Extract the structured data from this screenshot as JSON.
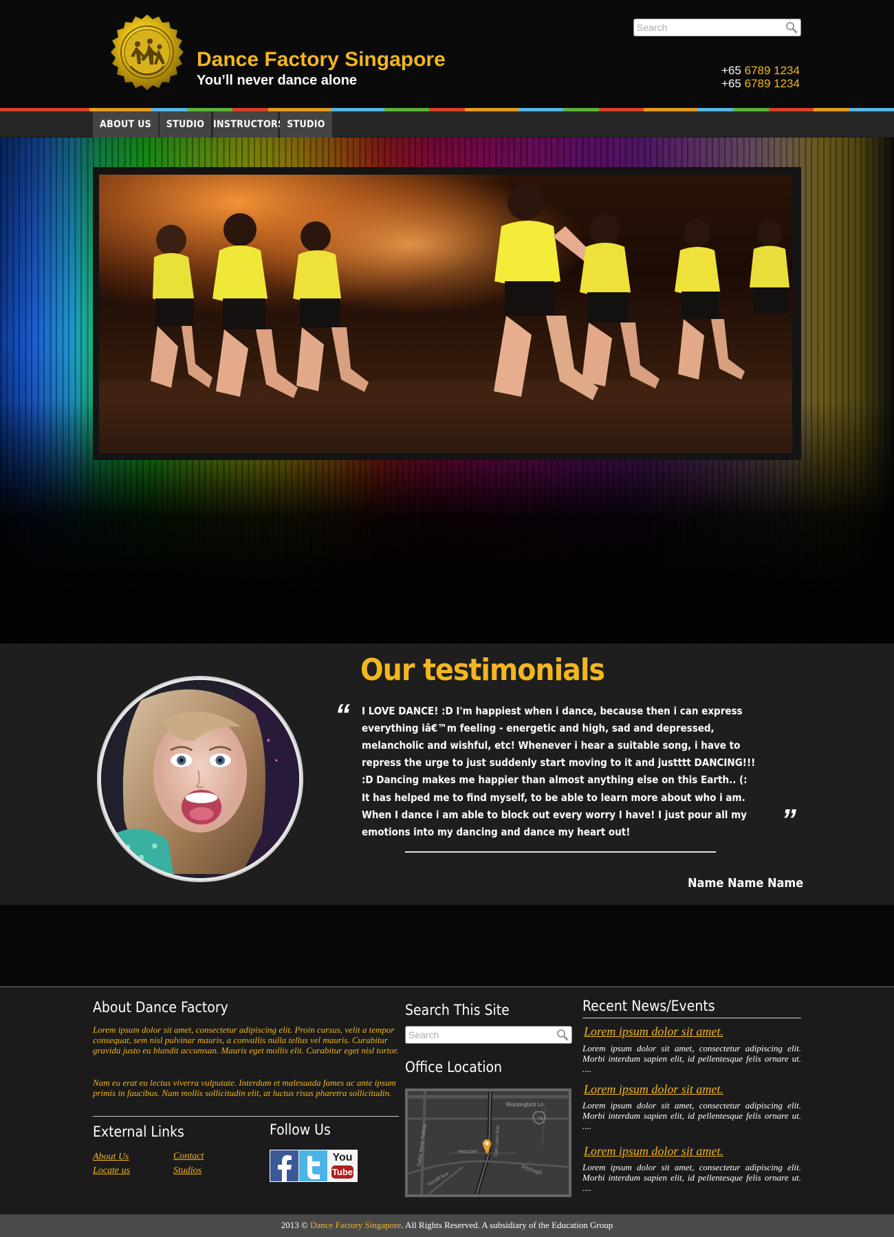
{
  "header": {
    "site_title": "Dance Factory Singapore",
    "tagline": "You’ll never dance alone",
    "search_placeholder": "Search",
    "phones": [
      {
        "prefix": "+65",
        "number": "6789 1234"
      },
      {
        "prefix": "+65",
        "number": "6789 1234"
      }
    ]
  },
  "nav": {
    "items": [
      {
        "label": "ABOUT US"
      },
      {
        "label": "STUDIO"
      },
      {
        "label": "INSTRUCTORS"
      },
      {
        "label": "STUDIO"
      }
    ]
  },
  "testimonials": {
    "title": "Our testimonials",
    "quote_open": "“",
    "quote_close": "”",
    "paragraph1": "I LOVE DANCE! :D I'm happiest when i dance, because then i can express everything iâ€™m feeling - energetic and high, sad and depressed, melancholic and wishful, etc! Whenever i hear a suitable song, i have to repress the urge to just suddenly start moving to it and justttt DANCING!!! :D Dancing makes me happier than almost anything else on this Earth.. (:",
    "paragraph2": "It has helped me to find myself, to be able to learn more about who i am. When I dance i am able to block out every worry I have! I just pour all my emotions into my dancing and dance my heart out!",
    "name": "Name Name Name"
  },
  "footer": {
    "about_heading": "About Dance Factory",
    "about_p1": "Lorem ipsum dolor sit amet, consectetur adipiscing elit. Proin cursus, velit a tempor consequat, sem nisl pulvinar mauris, a convallis nulla tellus vel mauris. Curabitur gravida justo eu blandit accumsan. Mauris eget mollis elit. Curabitur eget nisl tortor.",
    "about_p2": "Nam eu erat eu lectus viverra vulputate. Interdum et malesuada fames ac ante ipsum primis in faucibus. Nam mollis sollicitudin elit, at luctus risus pharetra sollicitudin.",
    "external_heading": "External Links",
    "links": [
      "About Us",
      "Contact",
      "Locate us",
      "Studios"
    ],
    "follow_heading": "Follow Us",
    "youtube_text_top": "You",
    "youtube_text_bottom": "Tube",
    "search_heading": "Search This Site",
    "search_placeholder": "Search",
    "office_heading": "Office Location",
    "map_labels": {
      "street1": "Mockingbird Ln",
      "street2": "Dallas North Tollway",
      "street3": "Oak Lawn Ave",
      "street4": "Herschel",
      "street5": "Wycliff Ave",
      "street6": "Fitzhugh",
      "shield": "75"
    },
    "news_heading": "Recent News/Events",
    "news": [
      {
        "title": "Lorem ipsum dolor sit amet.",
        "text": "Lorem ipsum dolor sit amet, consectetur adipiscing elit. Morbi interdum sapien elit, id pellentesque felis ornare ut. ...."
      },
      {
        "title": "Lorem ipsum dolor sit amet.",
        "text": "Lorem ipsum dolor sit amet, consectetur adipiscing elit. Morbi interdum sapien elit, id pellentesque felis ornare ut. ...."
      },
      {
        "title": "Lorem ipsum dolor sit amet.",
        "text": "Lorem ipsum dolor sit amet, consectetur adipiscing elit. Morbi interdum sapien elit, id pellentesque felis ornare ut. ...."
      }
    ]
  },
  "copyright": {
    "prefix": "2013 ©",
    "brand": "Dance Factory Singapore",
    "suffix": ". All Rights Reserved. A subsidiary of the  Education Group"
  },
  "colors": {
    "accent": "#f2b61f",
    "background": "#070707",
    "panel": "#1e1e1e"
  }
}
